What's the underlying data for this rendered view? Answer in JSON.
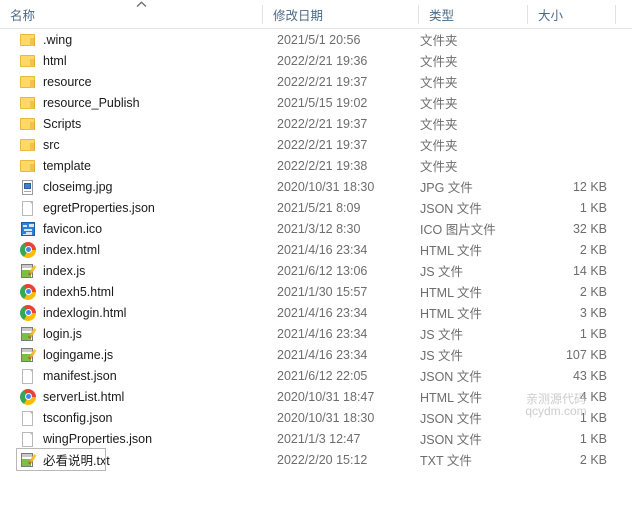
{
  "window": {
    "kind": "file-explorer-list-view",
    "sort_column": "名称",
    "sort_direction": "ascending"
  },
  "columns": {
    "name": "名称",
    "date_modified": "修改日期",
    "type": "类型",
    "size": "大小"
  },
  "types": {
    "folder": "文件夹",
    "jpg": "JPG 文件",
    "json": "JSON 文件",
    "ico": "ICO 图片文件",
    "html": "HTML 文件",
    "js": "JS 文件",
    "txt": "TXT 文件"
  },
  "files": [
    {
      "name": ".wing",
      "date": "2021/5/1 20:56",
      "type": "文件夹",
      "size": "",
      "icon": "folder-icon",
      "selected": false
    },
    {
      "name": "html",
      "date": "2022/2/21 19:36",
      "type": "文件夹",
      "size": "",
      "icon": "folder-icon",
      "selected": false
    },
    {
      "name": "resource",
      "date": "2022/2/21 19:37",
      "type": "文件夹",
      "size": "",
      "icon": "folder-icon",
      "selected": false
    },
    {
      "name": "resource_Publish",
      "date": "2021/5/15 19:02",
      "type": "文件夹",
      "size": "",
      "icon": "folder-icon",
      "selected": false
    },
    {
      "name": "Scripts",
      "date": "2022/2/21 19:37",
      "type": "文件夹",
      "size": "",
      "icon": "folder-icon",
      "selected": false
    },
    {
      "name": "src",
      "date": "2022/2/21 19:37",
      "type": "文件夹",
      "size": "",
      "icon": "folder-icon",
      "selected": false
    },
    {
      "name": "template",
      "date": "2022/2/21 19:38",
      "type": "文件夹",
      "size": "",
      "icon": "folder-icon",
      "selected": false
    },
    {
      "name": "closeimg.jpg",
      "date": "2020/10/31 18:30",
      "type": "JPG 文件",
      "size": "12 KB",
      "icon": "jpg-image-icon",
      "selected": false
    },
    {
      "name": "egretProperties.json",
      "date": "2021/5/21 8:09",
      "type": "JSON 文件",
      "size": "1 KB",
      "icon": "blank-document-icon",
      "selected": false
    },
    {
      "name": "favicon.ico",
      "date": "2021/3/12 8:30",
      "type": "ICO 图片文件",
      "size": "32 KB",
      "icon": "ico-image-icon",
      "selected": false
    },
    {
      "name": "index.html",
      "date": "2021/4/16 23:34",
      "type": "HTML 文件",
      "size": "2 KB",
      "icon": "chrome-browser-icon",
      "selected": false
    },
    {
      "name": "index.js",
      "date": "2021/6/12 13:06",
      "type": "JS 文件",
      "size": "14 KB",
      "icon": "script-editor-icon",
      "selected": false
    },
    {
      "name": "indexh5.html",
      "date": "2021/1/30 15:57",
      "type": "HTML 文件",
      "size": "2 KB",
      "icon": "chrome-browser-icon",
      "selected": false
    },
    {
      "name": "indexlogin.html",
      "date": "2021/4/16 23:34",
      "type": "HTML 文件",
      "size": "3 KB",
      "icon": "chrome-browser-icon",
      "selected": false
    },
    {
      "name": "login.js",
      "date": "2021/4/16 23:34",
      "type": "JS 文件",
      "size": "1 KB",
      "icon": "script-editor-icon",
      "selected": false
    },
    {
      "name": "logingame.js",
      "date": "2021/4/16 23:34",
      "type": "JS 文件",
      "size": "107 KB",
      "icon": "script-editor-icon",
      "selected": false
    },
    {
      "name": "manifest.json",
      "date": "2021/6/12 22:05",
      "type": "JSON 文件",
      "size": "43 KB",
      "icon": "blank-document-icon",
      "selected": false
    },
    {
      "name": "serverList.html",
      "date": "2020/10/31 18:47",
      "type": "HTML 文件",
      "size": "4 KB",
      "icon": "chrome-browser-icon",
      "selected": false
    },
    {
      "name": "tsconfig.json",
      "date": "2020/10/31 18:30",
      "type": "JSON 文件",
      "size": "1 KB",
      "icon": "blank-document-icon",
      "selected": false
    },
    {
      "name": "wingProperties.json",
      "date": "2021/1/3 12:47",
      "type": "JSON 文件",
      "size": "1 KB",
      "icon": "blank-document-icon",
      "selected": false
    },
    {
      "name": "必看说明.txt",
      "date": "2022/2/20 15:12",
      "type": "TXT 文件",
      "size": "2 KB",
      "icon": "script-editor-icon",
      "selected": true
    }
  ],
  "watermark": {
    "line1": "亲测源代码",
    "line2": "qcydm.com"
  }
}
